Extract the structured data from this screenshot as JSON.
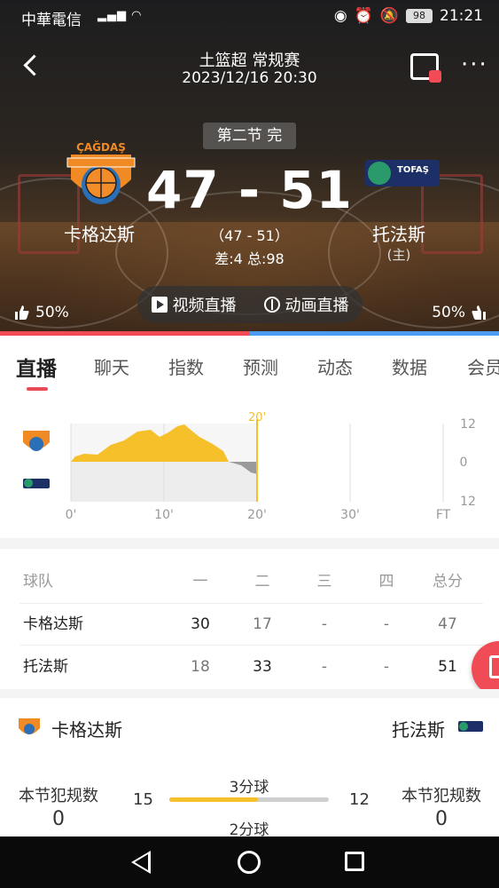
{
  "status_bar": {
    "carrier": "中華電信",
    "battery": "98",
    "time": "21:21"
  },
  "header": {
    "league": "土篮超 常规赛",
    "datetime": "2023/12/16 20:30"
  },
  "match": {
    "period": "第二节 完",
    "home_score_left": "47",
    "dash": "-",
    "away_score_right": "51",
    "half_score": "（47 - 51）",
    "diff_total": "差:4 总:98",
    "left_team": "卡格达斯",
    "right_team": "托法斯",
    "right_tag": "(主)",
    "left_support": "50%",
    "right_support": "50%",
    "left_support_value": 0.5,
    "right_support_value": 0.5
  },
  "live": {
    "video": "视频直播",
    "animation": "动画直播"
  },
  "tabs": [
    "直播",
    "聊天",
    "指数",
    "预测",
    "动态",
    "数据",
    "会员"
  ],
  "trend": {
    "marker": "20'",
    "x_labels": [
      "0'",
      "10'",
      "20'",
      "30'",
      "FT"
    ],
    "y_labels": [
      "12",
      "0",
      "12"
    ]
  },
  "score_table": {
    "headers": [
      "球队",
      "一",
      "二",
      "三",
      "四",
      "总分"
    ],
    "rows": [
      [
        "卡格达斯",
        "30",
        "17",
        "-",
        "-",
        "47"
      ],
      [
        "托法斯",
        "18",
        "33",
        "-",
        "-",
        "51"
      ]
    ]
  },
  "stats": {
    "left_team": "卡格达斯",
    "right_team": "托法斯",
    "foul_label": "本节犯规数",
    "left_fouls": "0",
    "right_fouls": "0",
    "three_label": "3分球",
    "three_left": "15",
    "three_right": "12",
    "three_left_share": 0.556,
    "two_label": "2分球"
  },
  "colors": {
    "accent": "#e84b55",
    "home_bar": "#f34b55",
    "away_bar": "#4b9bf3",
    "trend": "#f5c02a"
  }
}
